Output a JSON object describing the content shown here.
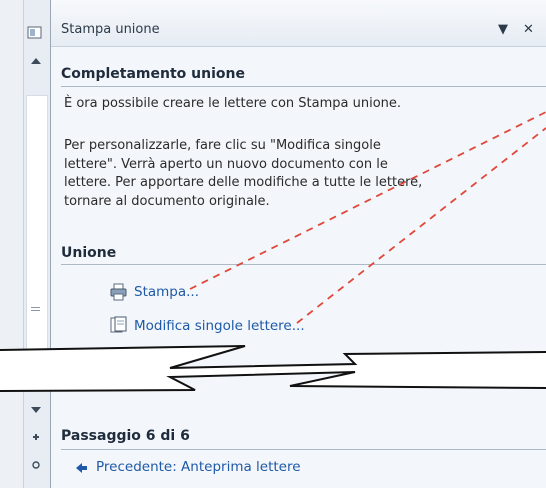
{
  "pane": {
    "title": "Stampa unione",
    "dropdown_glyph": "▼",
    "close_glyph": "✕"
  },
  "completion": {
    "heading": "Completamento unione",
    "line1": "È ora possibile creare le lettere con Stampa unione.",
    "para2_line1": "Per personalizzarle, fare clic su \"Modifica singole",
    "para2_line2": "lettere\". Verrà aperto un nuovo documento con le",
    "para2_line3": "lettere. Per apportare delle modifiche a tutte le lettere,",
    "para2_line4": "tornare al documento originale."
  },
  "merge": {
    "heading": "Unione",
    "print_link": "Stampa...",
    "edit_link": "Modifica singole lettere..."
  },
  "step": {
    "heading": "Passaggio 6 di 6",
    "previous_link": "Precedente: Anteprima lettere"
  },
  "icons": {
    "pane_icon": "taskpane-icon",
    "print_icon": "printer-icon",
    "edit_icon": "document-edit-icon",
    "back_icon": "arrow-left-icon"
  },
  "colors": {
    "link": "#1e5aa8",
    "callout": "#e0483a"
  }
}
